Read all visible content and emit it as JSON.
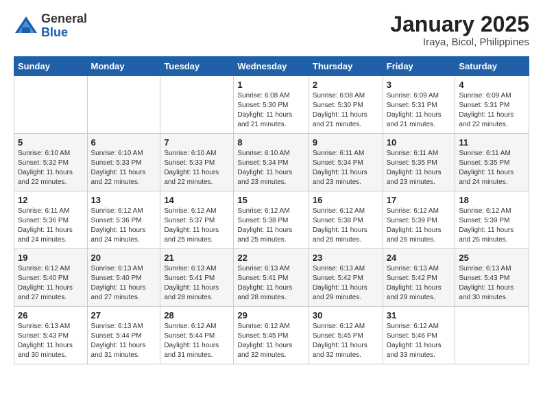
{
  "header": {
    "logo_general": "General",
    "logo_blue": "Blue",
    "title": "January 2025",
    "subtitle": "Iraya, Bicol, Philippines"
  },
  "days_of_week": [
    "Sunday",
    "Monday",
    "Tuesday",
    "Wednesday",
    "Thursday",
    "Friday",
    "Saturday"
  ],
  "weeks": [
    {
      "row_bg": "#fff",
      "days": [
        {
          "num": "",
          "detail": ""
        },
        {
          "num": "",
          "detail": ""
        },
        {
          "num": "",
          "detail": ""
        },
        {
          "num": "1",
          "detail": "Sunrise: 6:08 AM\nSunset: 5:30 PM\nDaylight: 11 hours\nand 21 minutes."
        },
        {
          "num": "2",
          "detail": "Sunrise: 6:08 AM\nSunset: 5:30 PM\nDaylight: 11 hours\nand 21 minutes."
        },
        {
          "num": "3",
          "detail": "Sunrise: 6:09 AM\nSunset: 5:31 PM\nDaylight: 11 hours\nand 21 minutes."
        },
        {
          "num": "4",
          "detail": "Sunrise: 6:09 AM\nSunset: 5:31 PM\nDaylight: 11 hours\nand 22 minutes."
        }
      ]
    },
    {
      "row_bg": "#f5f5f5",
      "days": [
        {
          "num": "5",
          "detail": "Sunrise: 6:10 AM\nSunset: 5:32 PM\nDaylight: 11 hours\nand 22 minutes."
        },
        {
          "num": "6",
          "detail": "Sunrise: 6:10 AM\nSunset: 5:33 PM\nDaylight: 11 hours\nand 22 minutes."
        },
        {
          "num": "7",
          "detail": "Sunrise: 6:10 AM\nSunset: 5:33 PM\nDaylight: 11 hours\nand 22 minutes."
        },
        {
          "num": "8",
          "detail": "Sunrise: 6:10 AM\nSunset: 5:34 PM\nDaylight: 11 hours\nand 23 minutes."
        },
        {
          "num": "9",
          "detail": "Sunrise: 6:11 AM\nSunset: 5:34 PM\nDaylight: 11 hours\nand 23 minutes."
        },
        {
          "num": "10",
          "detail": "Sunrise: 6:11 AM\nSunset: 5:35 PM\nDaylight: 11 hours\nand 23 minutes."
        },
        {
          "num": "11",
          "detail": "Sunrise: 6:11 AM\nSunset: 5:35 PM\nDaylight: 11 hours\nand 24 minutes."
        }
      ]
    },
    {
      "row_bg": "#fff",
      "days": [
        {
          "num": "12",
          "detail": "Sunrise: 6:11 AM\nSunset: 5:36 PM\nDaylight: 11 hours\nand 24 minutes."
        },
        {
          "num": "13",
          "detail": "Sunrise: 6:12 AM\nSunset: 5:36 PM\nDaylight: 11 hours\nand 24 minutes."
        },
        {
          "num": "14",
          "detail": "Sunrise: 6:12 AM\nSunset: 5:37 PM\nDaylight: 11 hours\nand 25 minutes."
        },
        {
          "num": "15",
          "detail": "Sunrise: 6:12 AM\nSunset: 5:38 PM\nDaylight: 11 hours\nand 25 minutes."
        },
        {
          "num": "16",
          "detail": "Sunrise: 6:12 AM\nSunset: 5:38 PM\nDaylight: 11 hours\nand 26 minutes."
        },
        {
          "num": "17",
          "detail": "Sunrise: 6:12 AM\nSunset: 5:39 PM\nDaylight: 11 hours\nand 26 minutes."
        },
        {
          "num": "18",
          "detail": "Sunrise: 6:12 AM\nSunset: 5:39 PM\nDaylight: 11 hours\nand 26 minutes."
        }
      ]
    },
    {
      "row_bg": "#f5f5f5",
      "days": [
        {
          "num": "19",
          "detail": "Sunrise: 6:12 AM\nSunset: 5:40 PM\nDaylight: 11 hours\nand 27 minutes."
        },
        {
          "num": "20",
          "detail": "Sunrise: 6:13 AM\nSunset: 5:40 PM\nDaylight: 11 hours\nand 27 minutes."
        },
        {
          "num": "21",
          "detail": "Sunrise: 6:13 AM\nSunset: 5:41 PM\nDaylight: 11 hours\nand 28 minutes."
        },
        {
          "num": "22",
          "detail": "Sunrise: 6:13 AM\nSunset: 5:41 PM\nDaylight: 11 hours\nand 28 minutes."
        },
        {
          "num": "23",
          "detail": "Sunrise: 6:13 AM\nSunset: 5:42 PM\nDaylight: 11 hours\nand 29 minutes."
        },
        {
          "num": "24",
          "detail": "Sunrise: 6:13 AM\nSunset: 5:42 PM\nDaylight: 11 hours\nand 29 minutes."
        },
        {
          "num": "25",
          "detail": "Sunrise: 6:13 AM\nSunset: 5:43 PM\nDaylight: 11 hours\nand 30 minutes."
        }
      ]
    },
    {
      "row_bg": "#fff",
      "days": [
        {
          "num": "26",
          "detail": "Sunrise: 6:13 AM\nSunset: 5:43 PM\nDaylight: 11 hours\nand 30 minutes."
        },
        {
          "num": "27",
          "detail": "Sunrise: 6:13 AM\nSunset: 5:44 PM\nDaylight: 11 hours\nand 31 minutes."
        },
        {
          "num": "28",
          "detail": "Sunrise: 6:12 AM\nSunset: 5:44 PM\nDaylight: 11 hours\nand 31 minutes."
        },
        {
          "num": "29",
          "detail": "Sunrise: 6:12 AM\nSunset: 5:45 PM\nDaylight: 11 hours\nand 32 minutes."
        },
        {
          "num": "30",
          "detail": "Sunrise: 6:12 AM\nSunset: 5:45 PM\nDaylight: 11 hours\nand 32 minutes."
        },
        {
          "num": "31",
          "detail": "Sunrise: 6:12 AM\nSunset: 5:46 PM\nDaylight: 11 hours\nand 33 minutes."
        },
        {
          "num": "",
          "detail": ""
        }
      ]
    }
  ]
}
